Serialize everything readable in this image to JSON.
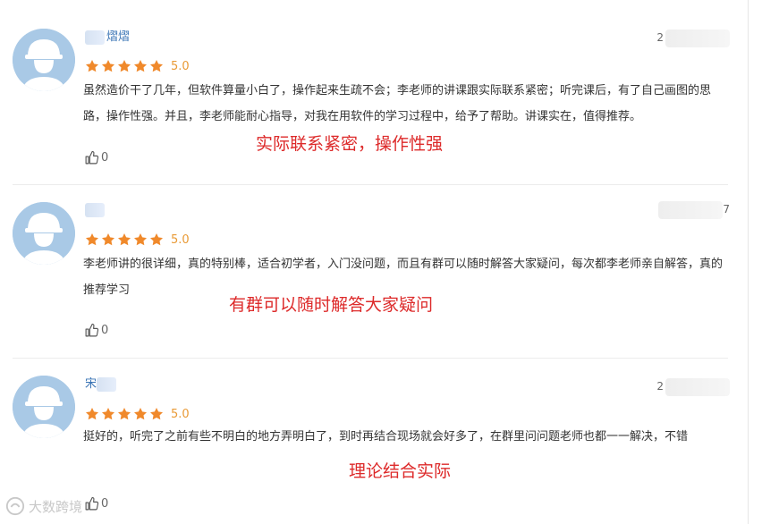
{
  "reviews": [
    {
      "name_visible": "熠熠",
      "date_visible": "2",
      "score": "5.0",
      "stars": 5,
      "comment": "虽然造价干了几年，但软件算量小白了，操作起来生疏不会；李老师的讲课跟实际联系紧密；听完课后，有了自己画图的思路，操作性强。并且，李老师能耐心指导，对我在用软件的学习过程中，给予了帮助。讲课实在，值得推荐。",
      "highlight": "实际联系紧密，操作性强",
      "likes": "0"
    },
    {
      "name_visible": "",
      "date_visible": "7",
      "score": "5.0",
      "stars": 5,
      "comment": "李老师讲的很详细，真的特别棒，适合初学者，入门没问题，而且有群可以随时解答大家疑问，每次都李老师亲自解答，真的推荐学习",
      "highlight": "有群可以随时解答大家疑问",
      "likes": "0"
    },
    {
      "name_visible": "宋",
      "date_visible": "2",
      "score": "5.0",
      "stars": 5,
      "comment": "挺好的，听完了之前有些不明白的地方弄明白了，到时再结合现场就会好多了，在群里问问题老师也都一一解决，不错",
      "highlight": "理论结合实际",
      "likes": "0"
    }
  ],
  "watermark": "大数跨境",
  "colors": {
    "star": "#f0892b",
    "score": "#e99a36",
    "highlight": "#dd2a2a",
    "name": "#3a74b5",
    "avatar_bg": "#a9c9e6"
  }
}
